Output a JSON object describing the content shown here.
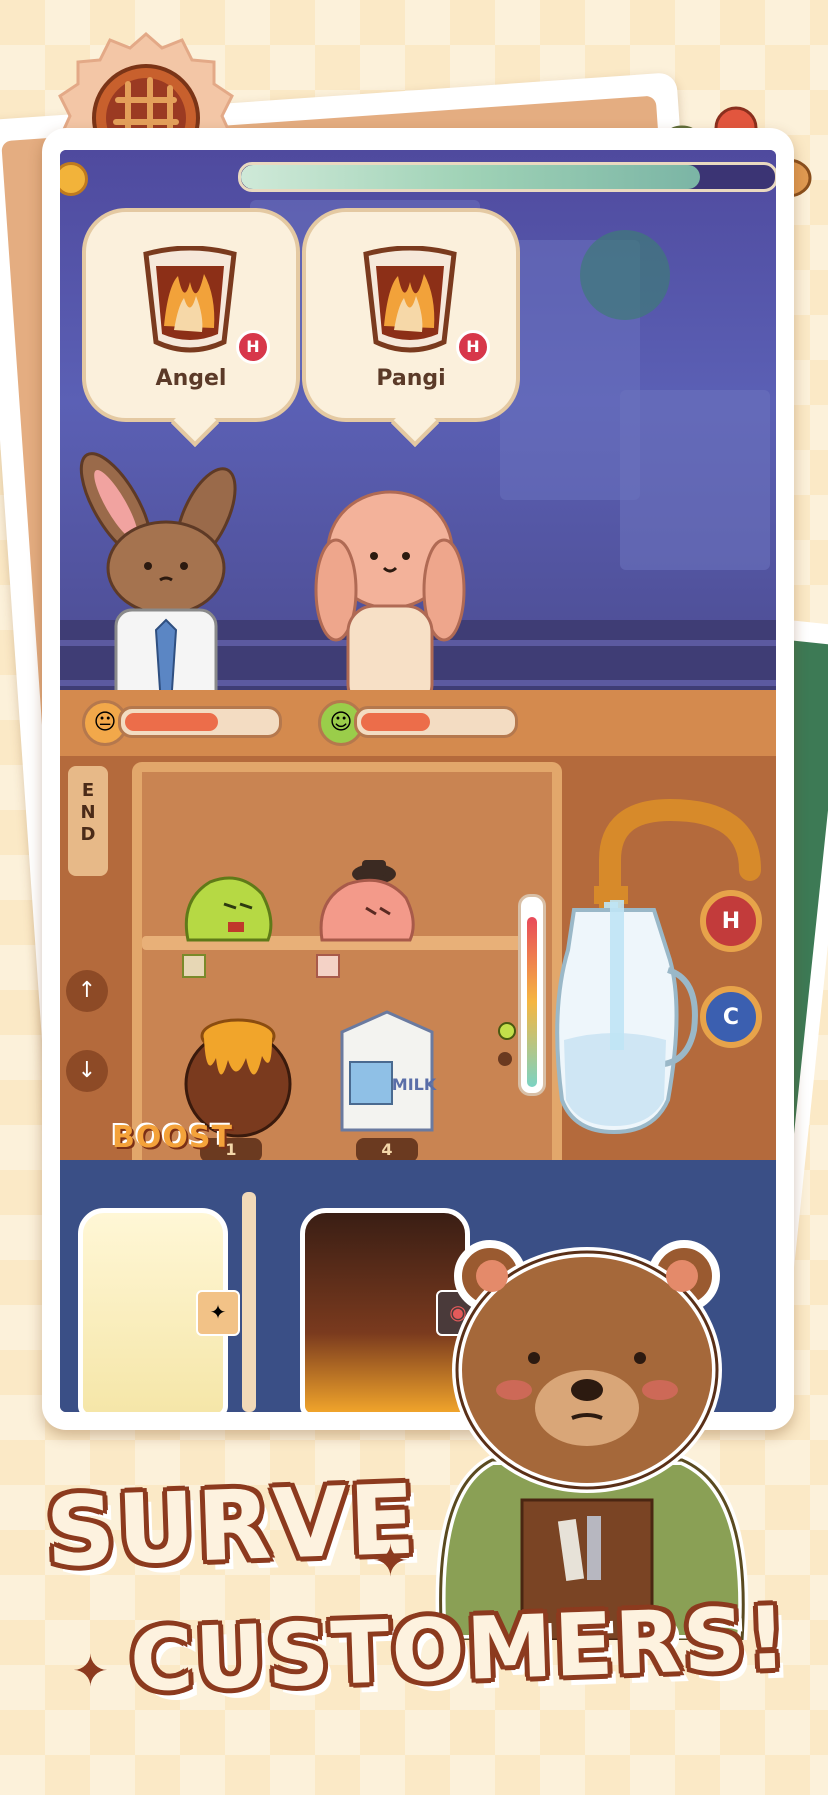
{
  "customers": [
    {
      "name": "Angel",
      "order_temp": "H"
    },
    {
      "name": "Pangi",
      "order_temp": "H"
    }
  ],
  "shift_progress": 0.86,
  "moods": [
    {
      "face": "😐",
      "fill": 0.62,
      "color": "#f2a84a"
    },
    {
      "face": "☺",
      "fill": 0.46,
      "color": "#9acd4a"
    }
  ],
  "sidebar": {
    "end_label": "E\nN\nD",
    "up_icon": "↑",
    "down_icon": "↓"
  },
  "ingredients": {
    "honey_count": "1",
    "milk_count": "4",
    "milk_label": "MILK"
  },
  "taps": {
    "hot_label": "H",
    "cold_label": "C"
  },
  "boost_label": "BOOST",
  "headline": {
    "line1": "SURVE",
    "line2": "CUSTOMERS!"
  },
  "colors": {
    "hot": "#d7374a",
    "cold": "#3b6fd1",
    "brand_outline": "#8c3a1e"
  }
}
